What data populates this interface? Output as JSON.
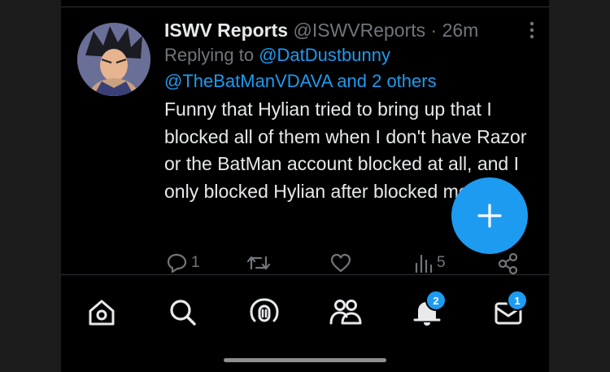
{
  "tweet": {
    "display_name": "ISWV Reports",
    "handle": "@ISWVReports",
    "separator": "·",
    "time": "26m",
    "replying_prefix": "Replying to",
    "reply_mention_1": "@DatDustbunny",
    "reply_mention_2": "@TheBatManVDAVA and 2 others",
    "body": "Funny that Hylian tried to bring up that I blocked all of them when I don't have Razor or the BatMan account blocked at all, and I only blocked Hylian after blocked me.",
    "reply_count": "1",
    "retweet_count": "",
    "like_count": "",
    "view_count": "5"
  },
  "nav": {
    "notifications_badge": "2",
    "messages_badge": "1"
  },
  "icons": {
    "reply": "comment-icon",
    "retweet": "retweet-icon",
    "like": "heart-icon",
    "views": "bar-chart-icon",
    "share": "share-icon",
    "compose": "plus-icon",
    "home": "home-icon",
    "search": "search-icon",
    "spaces": "microphone-icon",
    "communities": "people-icon",
    "notifications": "bell-icon",
    "messages": "envelope-icon"
  },
  "colors": {
    "background": "#000000",
    "accent": "#1d9bf0",
    "text_primary": "#e7e9ea",
    "text_secondary": "#71767b"
  }
}
